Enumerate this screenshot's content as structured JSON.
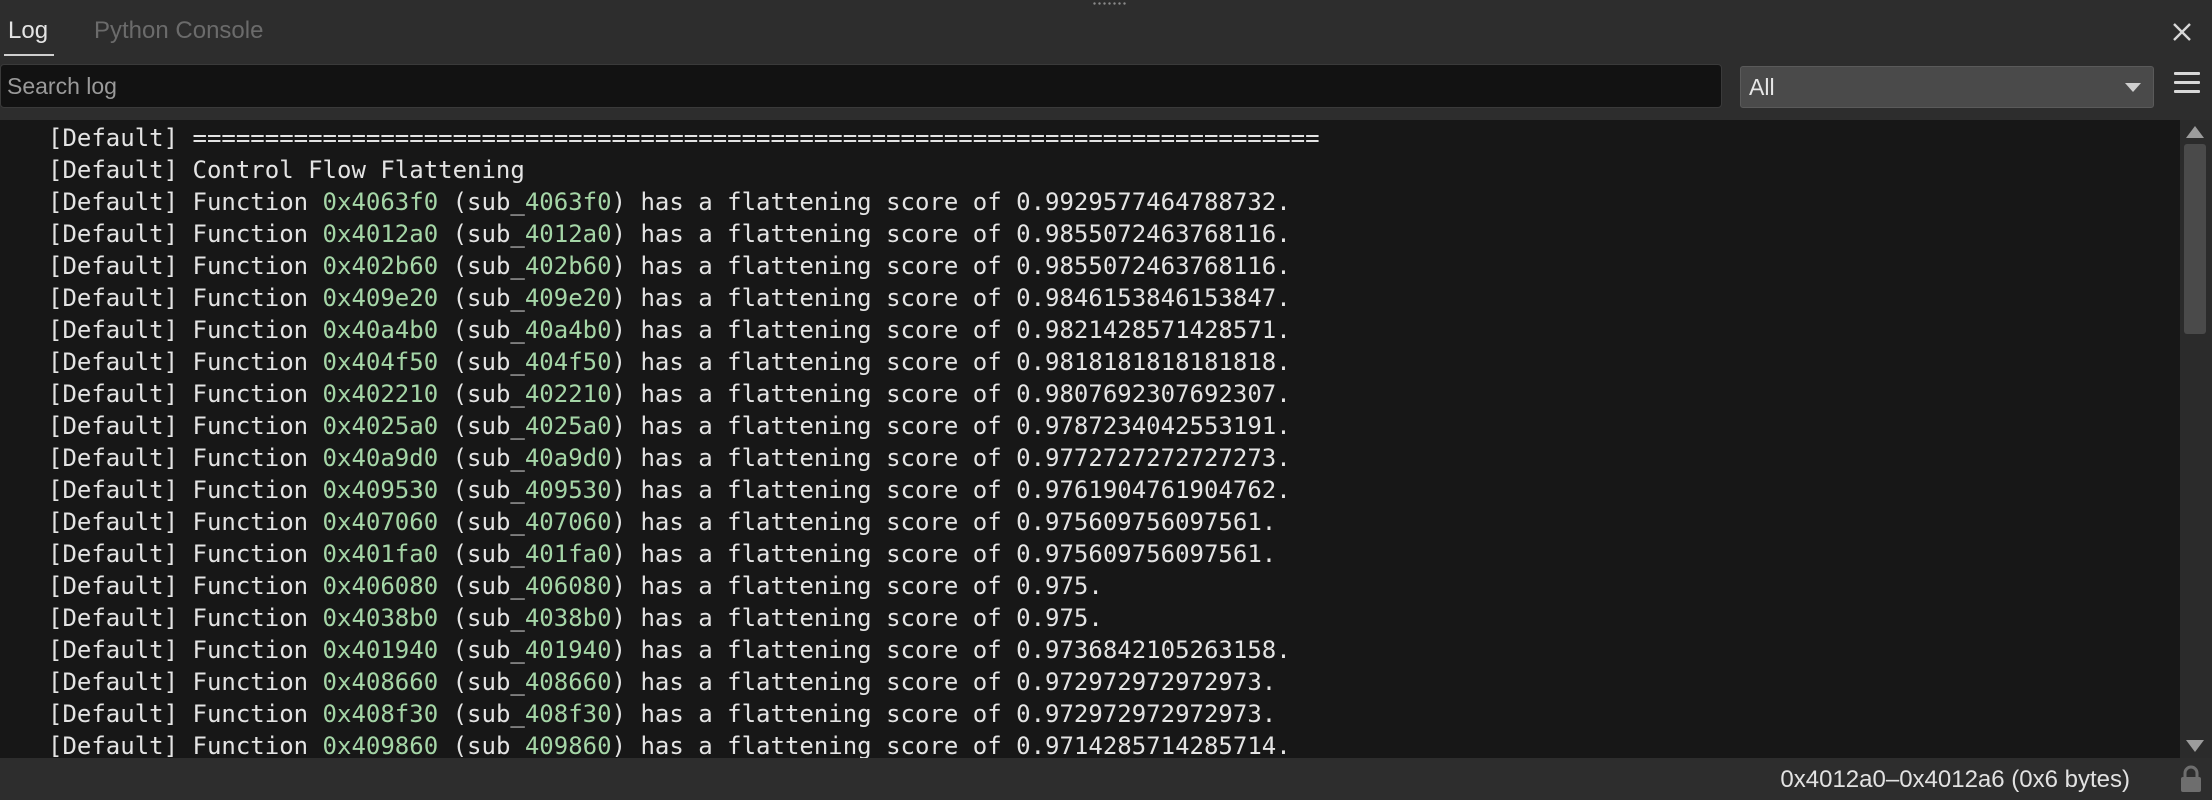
{
  "tabs": {
    "log": "Log",
    "python_console": "Python Console"
  },
  "search": {
    "placeholder": "Search log",
    "value": ""
  },
  "level_filter": {
    "selected": "All"
  },
  "icons": {
    "close": "close-icon",
    "menu": "hamburger-menu-icon",
    "dropdown": "chevron-down-icon",
    "lock": "lock-icon",
    "scroll_up": "scroll-up-arrow-icon",
    "scroll_down": "scroll-down-arrow-icon"
  },
  "colors": {
    "address": "#a5d6a7",
    "log_background": "#171717",
    "panel_background": "#2d2d2d"
  },
  "log": {
    "header_lines": [
      {
        "prefix": "[Default] ",
        "text": "=============================================================================="
      },
      {
        "prefix": "[Default] ",
        "text": "Control Flow Flattening"
      }
    ],
    "function_lines": [
      {
        "prefix": "[Default] ",
        "pre": "Function ",
        "addr": "0x4063f0",
        "mid": " (sub_",
        "sub": "4063f0",
        "post": ") has a flattening score of 0.9929577464788732."
      },
      {
        "prefix": "[Default] ",
        "pre": "Function ",
        "addr": "0x4012a0",
        "mid": " (sub_",
        "sub": "4012a0",
        "post": ") has a flattening score of 0.9855072463768116."
      },
      {
        "prefix": "[Default] ",
        "pre": "Function ",
        "addr": "0x402b60",
        "mid": " (sub_",
        "sub": "402b60",
        "post": ") has a flattening score of 0.9855072463768116."
      },
      {
        "prefix": "[Default] ",
        "pre": "Function ",
        "addr": "0x409e20",
        "mid": " (sub_",
        "sub": "409e20",
        "post": ") has a flattening score of 0.9846153846153847."
      },
      {
        "prefix": "[Default] ",
        "pre": "Function ",
        "addr": "0x40a4b0",
        "mid": " (sub_",
        "sub": "40a4b0",
        "post": ") has a flattening score of 0.9821428571428571."
      },
      {
        "prefix": "[Default] ",
        "pre": "Function ",
        "addr": "0x404f50",
        "mid": " (sub_",
        "sub": "404f50",
        "post": ") has a flattening score of 0.9818181818181818."
      },
      {
        "prefix": "[Default] ",
        "pre": "Function ",
        "addr": "0x402210",
        "mid": " (sub_",
        "sub": "402210",
        "post": ") has a flattening score of 0.9807692307692307."
      },
      {
        "prefix": "[Default] ",
        "pre": "Function ",
        "addr": "0x4025a0",
        "mid": " (sub_",
        "sub": "4025a0",
        "post": ") has a flattening score of 0.9787234042553191."
      },
      {
        "prefix": "[Default] ",
        "pre": "Function ",
        "addr": "0x40a9d0",
        "mid": " (sub_",
        "sub": "40a9d0",
        "post": ") has a flattening score of 0.9772727272727273."
      },
      {
        "prefix": "[Default] ",
        "pre": "Function ",
        "addr": "0x409530",
        "mid": " (sub_",
        "sub": "409530",
        "post": ") has a flattening score of 0.9761904761904762."
      },
      {
        "prefix": "[Default] ",
        "pre": "Function ",
        "addr": "0x407060",
        "mid": " (sub_",
        "sub": "407060",
        "post": ") has a flattening score of 0.975609756097561."
      },
      {
        "prefix": "[Default] ",
        "pre": "Function ",
        "addr": "0x401fa0",
        "mid": " (sub_",
        "sub": "401fa0",
        "post": ") has a flattening score of 0.975609756097561."
      },
      {
        "prefix": "[Default] ",
        "pre": "Function ",
        "addr": "0x406080",
        "mid": " (sub_",
        "sub": "406080",
        "post": ") has a flattening score of 0.975."
      },
      {
        "prefix": "[Default] ",
        "pre": "Function ",
        "addr": "0x4038b0",
        "mid": " (sub_",
        "sub": "4038b0",
        "post": ") has a flattening score of 0.975."
      },
      {
        "prefix": "[Default] ",
        "pre": "Function ",
        "addr": "0x401940",
        "mid": " (sub_",
        "sub": "401940",
        "post": ") has a flattening score of 0.9736842105263158."
      },
      {
        "prefix": "[Default] ",
        "pre": "Function ",
        "addr": "0x408660",
        "mid": " (sub_",
        "sub": "408660",
        "post": ") has a flattening score of 0.972972972972973."
      },
      {
        "prefix": "[Default] ",
        "pre": "Function ",
        "addr": "0x408f30",
        "mid": " (sub_",
        "sub": "408f30",
        "post": ") has a flattening score of 0.972972972972973."
      },
      {
        "prefix": "[Default] ",
        "pre": "Function ",
        "addr": "0x409860",
        "mid": " (sub_",
        "sub": "409860",
        "post": ") has a flattening score of 0.9714285714285714."
      }
    ]
  },
  "status": {
    "selection": "0x4012a0–0x4012a6 (0x6 bytes)"
  }
}
